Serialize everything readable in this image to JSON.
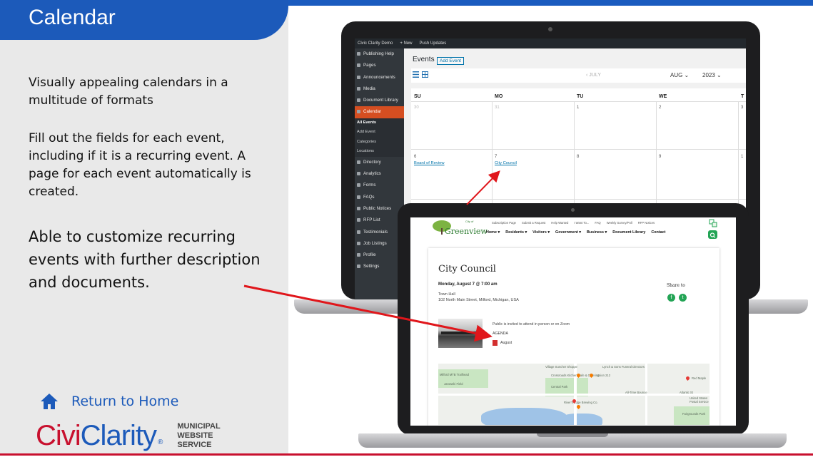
{
  "slide": {
    "title": "Calendar",
    "paragraph1": "Visually appealing calendars in a multitude of formats",
    "paragraph2": "Fill out the fields for each event, including if it is a recurring event.  A page for each event automatically is created.",
    "paragraph3": "Able to customize recurring events with further description and documents.",
    "home_link": "Return to Home",
    "logo": {
      "civic": "Civi",
      "clarity": "Clarity",
      "reg": "®",
      "tagline": [
        "MUNICIPAL",
        "WEBSITE",
        "SERVICE"
      ]
    },
    "colors": {
      "brand_blue": "#1c5aba",
      "brand_red": "#c8102e",
      "admin_accent": "#d54e21",
      "site_green": "#23a455"
    }
  },
  "admin": {
    "topbar": [
      "Civic Clarity Demo",
      "+ New",
      "Push Updates"
    ],
    "menu": [
      {
        "label": "Publishing Help",
        "icon": "help-icon"
      },
      {
        "label": "Pages",
        "icon": "pages-icon"
      },
      {
        "label": "Announcements",
        "icon": "announcement-icon"
      },
      {
        "label": "Media",
        "icon": "media-icon"
      },
      {
        "label": "Document Library",
        "icon": "document-icon"
      },
      {
        "label": "Calendar",
        "icon": "calendar-icon",
        "active": true
      }
    ],
    "submenu": [
      "All Events",
      "Add Event",
      "Categories",
      "Locations"
    ],
    "menu2": [
      {
        "label": "Directory",
        "icon": "directory-icon"
      },
      {
        "label": "Analytics",
        "icon": "analytics-icon"
      },
      {
        "label": "Forms",
        "icon": "forms-icon"
      },
      {
        "label": "FAQs",
        "icon": "faq-icon"
      },
      {
        "label": "Public Notices",
        "icon": "notice-icon"
      },
      {
        "label": "RFP List",
        "icon": "rfp-icon"
      },
      {
        "label": "Testimonials",
        "icon": "testimonial-icon"
      },
      {
        "label": "Job Listings",
        "icon": "job-icon"
      },
      {
        "label": "Profile",
        "icon": "profile-icon"
      },
      {
        "label": "Settings",
        "icon": "settings-icon"
      }
    ],
    "events_heading": "Events",
    "add_event_button": "Add Event",
    "prev_month": "‹ JULY",
    "month": "AUG ⌄",
    "year": "2023 ⌄",
    "weekdays": [
      "SU",
      "MO",
      "TU",
      "WE",
      "T"
    ],
    "week1": [
      "30",
      "31",
      "1",
      "2",
      "3"
    ],
    "week2": [
      "6",
      "7",
      "8",
      "9",
      "1"
    ],
    "events": {
      "board": "Board of Review",
      "council": "City Council"
    }
  },
  "site": {
    "city_of": "City of",
    "city_name": "Greenview",
    "utility_nav": [
      "Subscription Page",
      "Submit a Request",
      "Help Wanted",
      "I Want To...",
      "FAQ",
      "Weekly Survey/Poll",
      "RFP Notices"
    ],
    "main_nav": [
      "Home ▾",
      "Residents ▾",
      "Visitors ▾",
      "Government ▾",
      "Business ▾",
      "Document Library",
      "Contact"
    ],
    "event": {
      "title": "City Council",
      "datetime": "Monday, August 7 @ 7:00 am",
      "venue": "Town Hall",
      "address": "102 North Main Street, Milford, Michigan, USA",
      "description": "Public is invited to attend in person or on Zoom",
      "agenda": "AGENDA",
      "document": "August",
      "share_label": "Share to"
    },
    "map_labels": [
      "Village Suncher Shoppe",
      "Lynch & Sons Funeral Directors",
      "Milford MTB Trailhead",
      "Crossroads Kitchen Cafe & Catering",
      "Union 212",
      "Red Maple",
      "Jarowski Field",
      "Central Park",
      "All-Time Bounce",
      "Atlantic St",
      "United States Postal Service",
      "River's Edge Brewing Co.",
      "Fairgrounds Park"
    ]
  }
}
